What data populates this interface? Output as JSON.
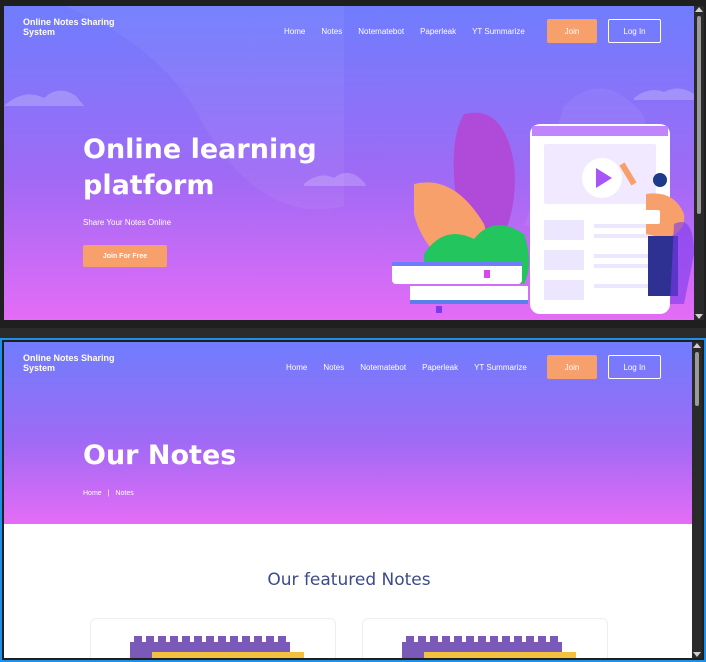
{
  "brand": {
    "name": "Online Notes Sharing System"
  },
  "nav": {
    "items": [
      "Home",
      "Notes",
      "Notematebot",
      "Paperleak",
      "YT Summarize"
    ],
    "join": "Join",
    "login": "Log In"
  },
  "hero_home": {
    "title_line1": "Online learning",
    "title_line2": "platform",
    "subtitle": "Share Your Notes Online",
    "cta": "Join For Free"
  },
  "hero_notes": {
    "title": "Our Notes",
    "breadcrumb_home": "Home",
    "breadcrumb_sep": "|",
    "breadcrumb_current": "Notes"
  },
  "featured": {
    "title": "Our featured Notes"
  },
  "colors": {
    "accent": "#f7a06c",
    "gradient_top": "#6f7dfd",
    "gradient_bottom": "#e46cf6",
    "heading": "#3c4a8a",
    "selection_border": "#1e90e8"
  }
}
